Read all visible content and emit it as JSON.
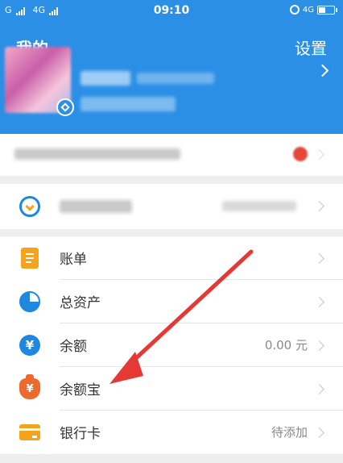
{
  "status_bar": {
    "carrier1": "G",
    "carrier2": "4G",
    "time": "09:10",
    "network": "4G"
  },
  "header": {
    "title": "我的",
    "settings_label": "设置"
  },
  "menu": [
    {
      "label": "账单",
      "value": "",
      "icon": "bill-icon"
    },
    {
      "label": "总资产",
      "value": "",
      "icon": "pie-chart-icon"
    },
    {
      "label": "余额",
      "value": "0.00 元",
      "icon": "yen-circle-icon"
    },
    {
      "label": "余额宝",
      "value": "",
      "icon": "money-bag-icon"
    },
    {
      "label": "银行卡",
      "value": "待添加",
      "icon": "bank-card-icon"
    }
  ],
  "colors": {
    "header_blue": "#2b8fe6",
    "icon_blue": "#1e87e0",
    "icon_orange": "#f5a21c",
    "annotation_red": "#e53935"
  }
}
